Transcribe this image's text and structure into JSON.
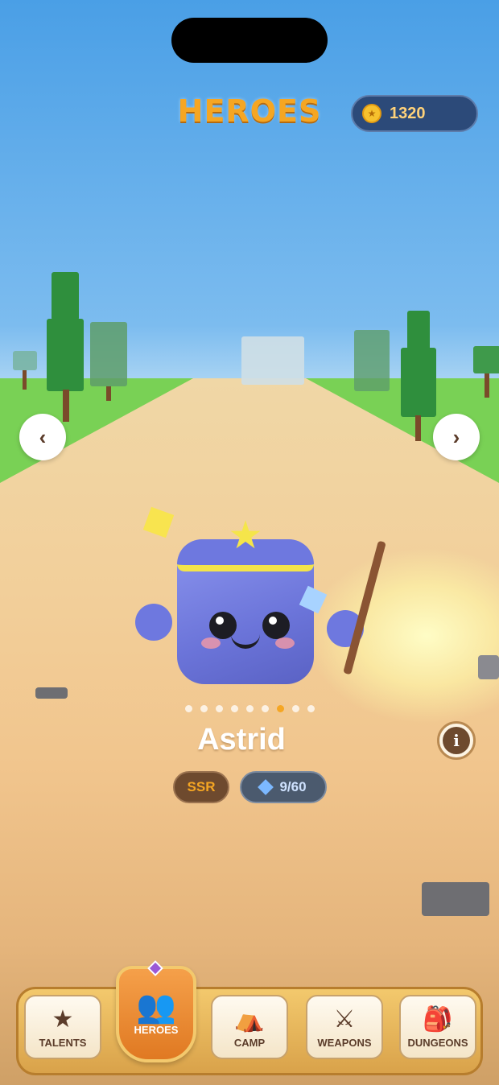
{
  "header": {
    "title": "HEROES",
    "coins": "1320",
    "coin_icon": "coin-icon"
  },
  "carousel": {
    "prev_symbol": "‹",
    "next_symbol": "›",
    "page_count": 9,
    "active_index": 6
  },
  "hero": {
    "name": "Astrid",
    "rarity": "SSR",
    "shards": "9/60",
    "info_symbol": "i"
  },
  "tabs": [
    {
      "label": "TALENTS",
      "icon": "star-icon",
      "glyph": "★"
    },
    {
      "label": "HEROES",
      "icon": "users-icon",
      "glyph": "👥"
    },
    {
      "label": "CAMP",
      "icon": "tent-icon",
      "glyph": "⛺"
    },
    {
      "label": "WEAPONS",
      "icon": "swords-icon",
      "glyph": "⚔"
    },
    {
      "label": "DUNGEONS",
      "icon": "backpack-icon",
      "glyph": "🎒"
    }
  ],
  "colors": {
    "accent": "#f5a623",
    "sky": "#4a9fe6",
    "bar": "#d9a24a"
  }
}
